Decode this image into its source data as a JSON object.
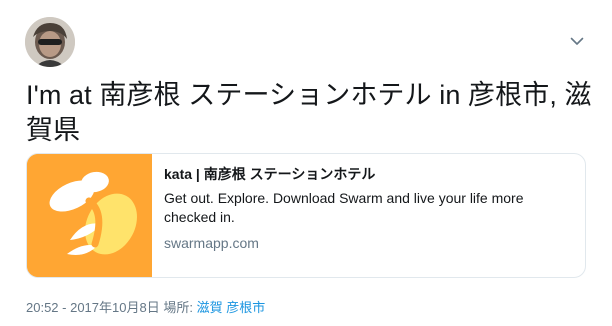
{
  "tweet": {
    "avatar_icon": "user-avatar-photo",
    "menu_icon": "chevron-down-icon",
    "text": "I'm at 南彦根 ステーションホテル in 彦根市, 滋賀県"
  },
  "card": {
    "thumbnail_icon": "swarm-bee-logo",
    "thumbnail_color": "#ffa633",
    "title": "kata | 南彦根 ステーションホテル",
    "description": "Get out. Explore. Download Swarm and live your life more checked in.",
    "domain": "swarmapp.com"
  },
  "meta": {
    "timestamp": "20:52 - 2017年10月8日",
    "place_prefix": "場所:",
    "place_link": "滋賀 彦根市"
  },
  "colors": {
    "text": "#14171a",
    "secondary": "#657786",
    "link": "#1b95e0",
    "border": "#e1e8ed"
  }
}
